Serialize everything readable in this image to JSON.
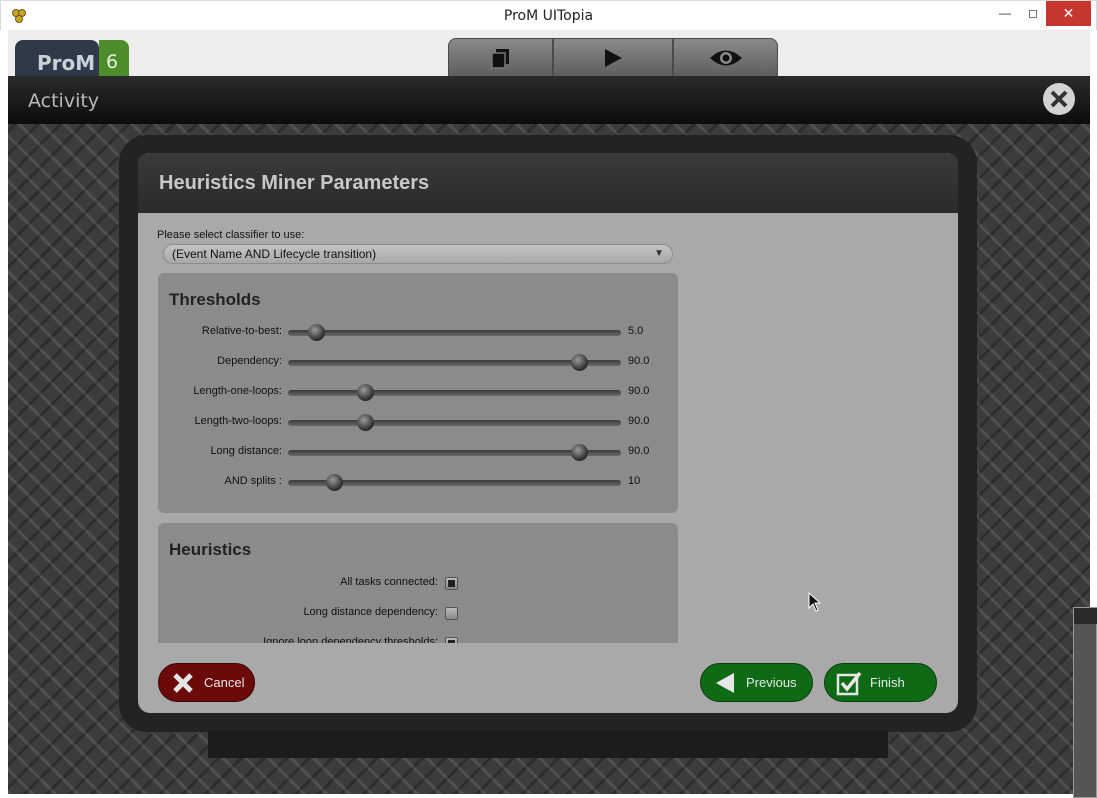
{
  "window": {
    "title": "ProM UITopia",
    "minimize_icon": "minimize-icon",
    "maximize_icon": "maximize-icon",
    "close_icon": "close-icon"
  },
  "logo": {
    "main": "ProM",
    "version": "6"
  },
  "tabs": [
    {
      "icon": "workspace-icon"
    },
    {
      "icon": "play-icon"
    },
    {
      "icon": "eye-icon"
    }
  ],
  "activity": {
    "title": "Activity",
    "close_icon": "close-circle-icon"
  },
  "dialog": {
    "title": "Heuristics Miner Parameters",
    "classifier_label": "Please select classifier to use:",
    "classifier_value": "(Event Name AND Lifecycle transition)",
    "thresholds": {
      "title": "Thresholds",
      "rows": [
        {
          "label": "Relative-to-best:",
          "value": "5.0",
          "level": 0.05
        },
        {
          "label": "Dependency:",
          "value": "90.0",
          "level": 0.9
        },
        {
          "label": "Length-one-loops:",
          "value": "90.0",
          "level": 0.21
        },
        {
          "label": "Length-two-loops:",
          "value": "90.0",
          "level": 0.21
        },
        {
          "label": "Long distance:",
          "value": "90.0",
          "level": 0.9
        },
        {
          "label": "AND splits :",
          "value": "10",
          "level": 0.11
        }
      ]
    },
    "heuristics": {
      "title": "Heuristics",
      "options": [
        {
          "label": "All tasks connected:",
          "checked": true
        },
        {
          "label": "Long distance dependency:",
          "checked": false
        },
        {
          "label": "Ignore loop dependency thresholds:",
          "checked": true
        }
      ]
    },
    "buttons": {
      "cancel": "Cancel",
      "previous": "Previous",
      "finish": "Finish"
    }
  },
  "colors": {
    "cancel": "#6b0a0a",
    "ok": "#0f6a15",
    "close": "#c7372f",
    "logo_blue": "#2e3a47",
    "logo_green": "#4c8c2b"
  }
}
